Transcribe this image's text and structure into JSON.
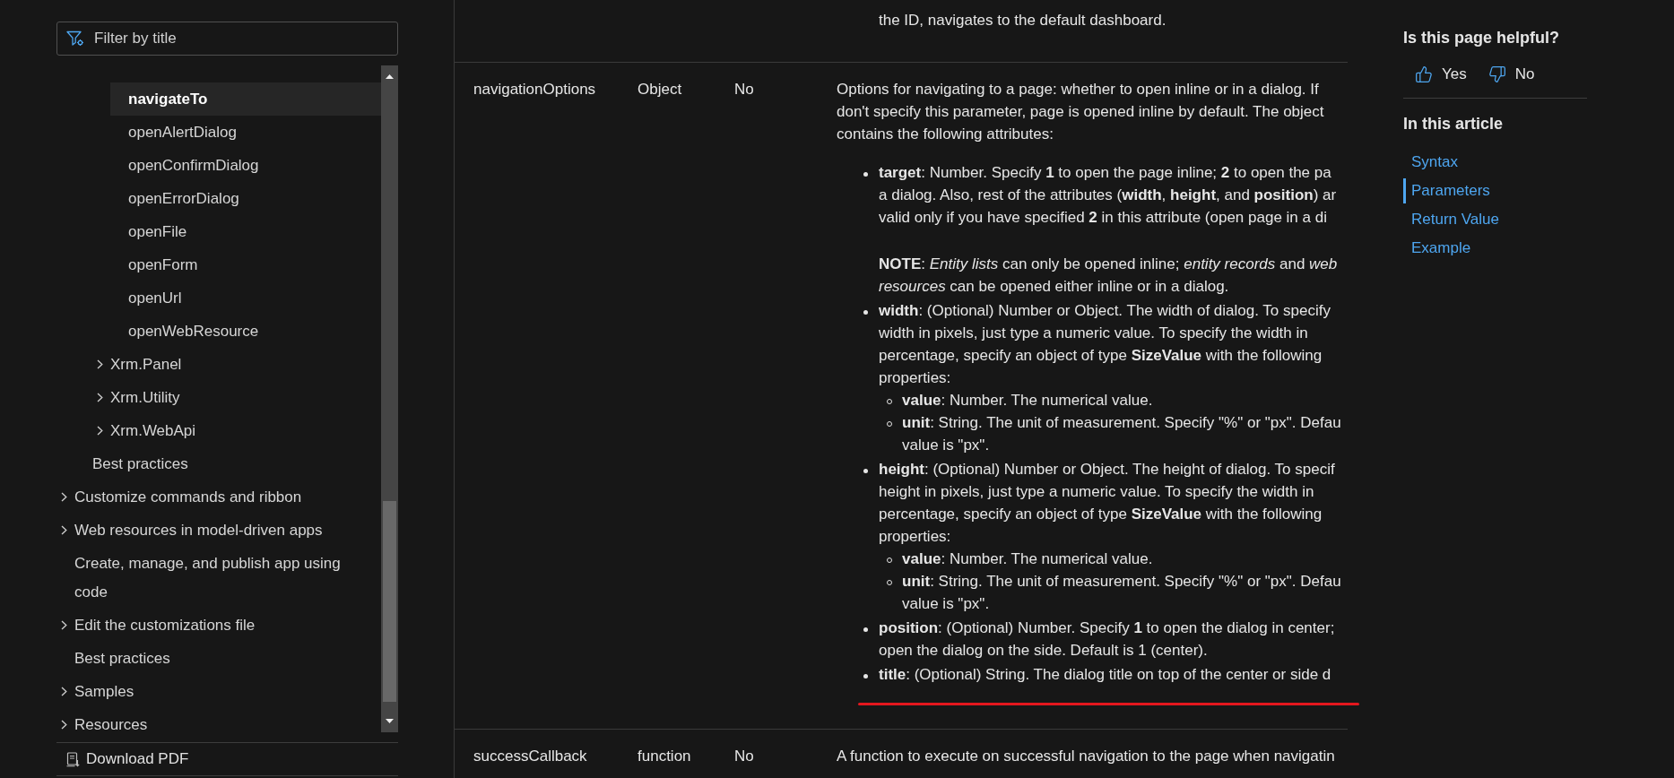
{
  "sidebar": {
    "filter": {
      "placeholder": "Filter by title"
    },
    "tree": [
      {
        "children": [
          {
            "children": [
              {
                "children": [
                  {
                    "label": "navigateTo",
                    "selected": true
                  },
                  {
                    "label": "openAlertDialog",
                    "selected": false
                  },
                  {
                    "label": "openConfirmDialog",
                    "selected": false
                  },
                  {
                    "label": "openErrorDialog",
                    "selected": false
                  },
                  {
                    "label": "openFile",
                    "selected": false
                  },
                  {
                    "label": "openForm",
                    "selected": false
                  },
                  {
                    "label": "openUrl",
                    "selected": false
                  },
                  {
                    "label": "openWebResource",
                    "selected": false
                  }
                ]
              },
              {
                "label": "Xrm.Panel",
                "expanded": false,
                "selected": false
              },
              {
                "label": "Xrm.Utility",
                "expanded": false,
                "selected": false
              },
              {
                "label": "Xrm.WebApi",
                "expanded": false,
                "selected": false
              }
            ]
          },
          {
            "label": "Best practices",
            "selected": false
          }
        ]
      },
      {
        "label": "Customize commands and ribbon",
        "expanded": false,
        "selected": false
      },
      {
        "label": "Web resources in model-driven apps",
        "expanded": false,
        "selected": false
      },
      {
        "label": "Create, manage, and publish app using code",
        "selected": false
      },
      {
        "label": "Edit the customizations file",
        "expanded": false,
        "selected": false
      },
      {
        "label": "Best practices",
        "selected": false
      },
      {
        "label": "Samples",
        "expanded": false,
        "selected": false
      },
      {
        "label": "Resources",
        "expanded": false,
        "selected": false
      }
    ],
    "download": {
      "label": "Download PDF"
    }
  },
  "parameters_table": {
    "rows": [
      {
        "description": {
          "indented_lines": [
            "the ID, navigates to the default dashboard."
          ]
        }
      },
      {
        "name": "navigationOptions",
        "type": "Object",
        "required": "No",
        "description": {
          "intro": [
            "Options for navigating to a page: whether to open inline or in a dialog. If",
            "don't specify this parameter, page is opened inline by default. The object",
            "contains the following attributes:"
          ],
          "bullets": [
            {
              "paragraphs": [
                [
                  "**target**: Number. Specify **1** to open the page inline; **2** to open the pa",
                  "a dialog. Also, rest of the attributes (**width**, **height**, and **position**) ar",
                  "valid only if you have specified **2** in this attribute (open page in a di"
                ],
                [
                  "**NOTE**: *Entity lists* can only be opened inline; *entity records* and *web*",
                  "*resources* can be opened either inline or in a dialog."
                ]
              ],
              "underlined": false
            },
            {
              "paragraphs": [
                [
                  "**width**: (Optional) Number or Object. The width of dialog. To specify",
                  "width in pixels, just type a numeric value. To specify the width in",
                  "percentage, specify an object of type **SizeValue** with the following",
                  "properties:"
                ]
              ],
              "sub_bullets": [
                [
                  "**value**: Number. The numerical value."
                ],
                [
                  "**unit**: String. The unit of measurement. Specify \"%\" or \"px\". Defau",
                  "value is \"px\"."
                ]
              ],
              "underlined": false
            },
            {
              "paragraphs": [
                [
                  "**height**: (Optional) Number or Object. The height of dialog. To specif",
                  "height in pixels, just type a numeric value. To specify the width in",
                  "percentage, specify an object of type **SizeValue** with the following",
                  "properties:"
                ]
              ],
              "sub_bullets": [
                [
                  "**value**: Number. The numerical value."
                ],
                [
                  "**unit**: String. The unit of measurement. Specify \"%\" or \"px\". Defau",
                  "value is \"px\"."
                ]
              ],
              "underlined": false
            },
            {
              "paragraphs": [
                [
                  "**position**: (Optional) Number. Specify **1** to open the dialog in center;",
                  "open the dialog on the side. Default is 1 (center)."
                ]
              ],
              "underlined": false
            },
            {
              "paragraphs": [
                [
                  "**title**: (Optional) String. The dialog title on top of the center or side d"
                ]
              ],
              "underlined": true
            }
          ]
        }
      },
      {
        "name": "successCallback",
        "type": "function",
        "required": "No",
        "description": {
          "intro": [
            "A function to execute on successful navigation to the page when navigatin"
          ]
        }
      }
    ]
  },
  "feedback": {
    "title": "Is this page helpful?",
    "buttons": [
      {
        "kind": "thumbs_up",
        "label": "Yes"
      },
      {
        "kind": "thumbs_down",
        "label": "No"
      }
    ]
  },
  "toc": {
    "title": "In this article",
    "links": [
      {
        "label": "Syntax",
        "selected": false
      },
      {
        "label": "Parameters",
        "selected": true
      },
      {
        "label": "Return Value",
        "selected": false
      },
      {
        "label": "Example",
        "selected": false
      }
    ]
  }
}
